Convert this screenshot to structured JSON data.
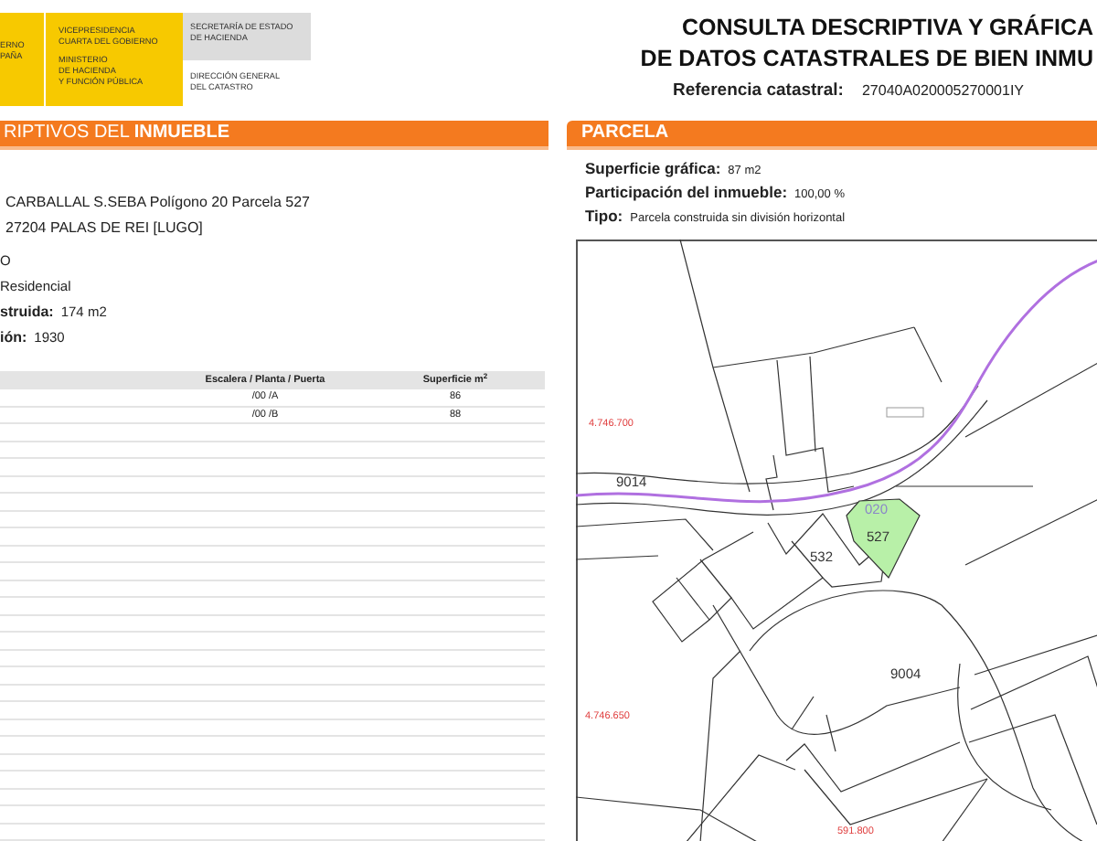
{
  "logo": {
    "crest_text": "ERNO\nPAÑA",
    "ministry_lines": [
      "VICEPRESIDENCIA\nCUARTA DEL GOBIERNO",
      "MINISTERIO\nDE HACIENDA\nY FUNCIÓN PÚBLICA"
    ],
    "secretariat": "SECRETARÍA DE ESTADO\nDE HACIENDA",
    "directorate": "DIRECCIÓN GENERAL\nDEL CATASTRO"
  },
  "header": {
    "title_lines": [
      "CONSULTA DESCRIPTIVA Y GRÁFICA",
      "DE DATOS CATASTRALES DE BIEN INMU"
    ],
    "reference_label": "Referencia catastral:",
    "reference_value": "27040A020005270001IY"
  },
  "property_section": {
    "heading": "RIPTIVOS DEL **INMUEBLE**",
    "address_lines": [
      "CARBALLAL S.SEBA  Polígono 20 Parcela 527",
      "27204 PALAS DE REI [LUGO]"
    ],
    "fields": [
      {
        "value": "O"
      },
      {
        "value": "Residencial"
      },
      {
        "label": "struida:",
        "value": "174 m2"
      },
      {
        "label": "ión:",
        "value": "1930"
      }
    ],
    "table": {
      "columns": [
        "Escalera / Planta / Puerta",
        "Superficie m$^{2}$"
      ],
      "rows": [
        [
          "/00 /A",
          "86"
        ],
        [
          "/00 /B",
          "88"
        ]
      ]
    }
  },
  "parcel_section": {
    "heading": "PARCELA",
    "fields": [
      {
        "label": "Superficie gráfica:",
        "value": "87 m2"
      },
      {
        "label": "Participación del inmueble:",
        "value": "100,00 %"
      },
      {
        "label": "Tipo:",
        "value": "Parcela construida sin división horizontal"
      }
    ],
    "map": {
      "labels": [
        {
          "kind": "coordinate",
          "text": "4.746.700"
        },
        {
          "kind": "road",
          "text": "9014"
        },
        {
          "kind": "polygon",
          "text": "020"
        },
        {
          "kind": "parcel",
          "text": "527"
        },
        {
          "kind": "parcel",
          "text": "532"
        },
        {
          "kind": "road",
          "text": "9004"
        },
        {
          "kind": "coordinate",
          "text": "4.746.650"
        },
        {
          "kind": "coordinate",
          "text": "591.800"
        }
      ]
    }
  }
}
